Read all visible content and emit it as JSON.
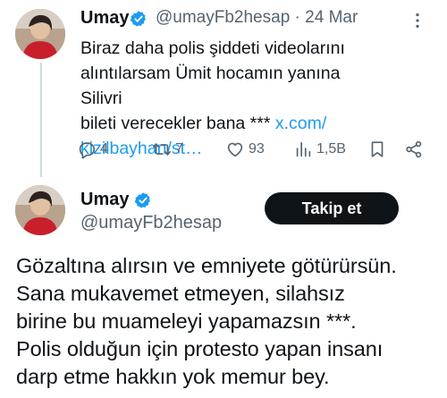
{
  "tweet1": {
    "author_name": "Umay",
    "handle": "@umayFb2hesap",
    "separator": "·",
    "date": "24 Mar",
    "text_line1": "Biraz daha polis şiddeti videolarını",
    "text_line2": "alıntılarsam Ümit hocamın yanına Silivri",
    "text_line3": "bileti verecekler bana *** ",
    "link_part1": "x.com/",
    "link_part2": "kizilbayhan/st…",
    "stats": {
      "replies": "4",
      "reposts": "7",
      "likes": "93",
      "views": "1,5B"
    },
    "icons": [
      "reply-icon",
      "repost-icon",
      "like-icon",
      "views-icon",
      "bookmark-icon",
      "share-icon",
      "more-icon",
      "verified-icon"
    ]
  },
  "tweet2": {
    "author_name": "Umay",
    "handle": "@umayFb2hesap",
    "follow_label": "Takip et",
    "lines": [
      "Gözaltına alırsın ve emniyete götürürsün.",
      "Sana mukavemet etmeyen, silahsız",
      "birine bu muameleyi yapamazsın ***.",
      "Polis olduğun için protesto yapan insanı",
      "darp etme hakkın yok memur bey."
    ]
  },
  "colors": {
    "accent": "#1d9bf0",
    "muted": "#536471",
    "text": "#0f1419",
    "line": "#cfd9de"
  }
}
